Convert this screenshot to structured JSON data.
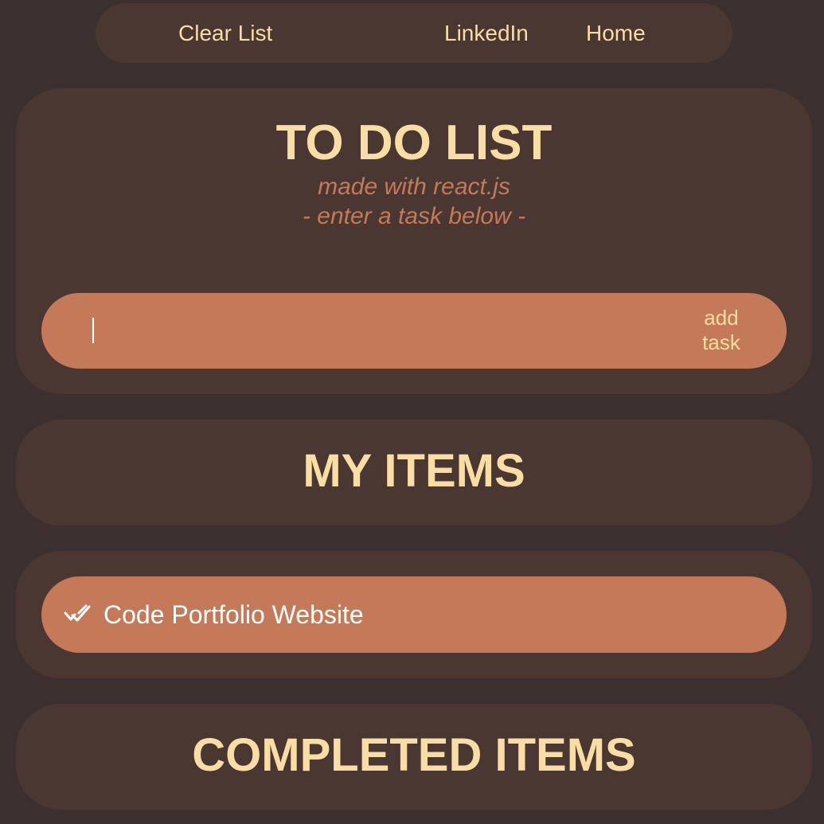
{
  "nav": {
    "clear_label": "Clear List",
    "linkedin_label": "LinkedIn",
    "home_label": "Home"
  },
  "header": {
    "title": "TO DO LIST",
    "subtitle": "made with react.js",
    "instruction": "- enter a task below -"
  },
  "task_input": {
    "value": "",
    "placeholder": "",
    "add_label_line1": "add",
    "add_label_line2": "task"
  },
  "my_items": {
    "title": "MY ITEMS",
    "items": [
      {
        "text": "Code Portfolio Website",
        "icon": "double-check-icon"
      }
    ]
  },
  "completed_items": {
    "title": "COMPLETED ITEMS"
  },
  "colors": {
    "background": "#3b2f2f",
    "card": "#4a3732",
    "accent": "#c47a58",
    "heading": "#f8dda4",
    "item_text": "#ffffff"
  }
}
